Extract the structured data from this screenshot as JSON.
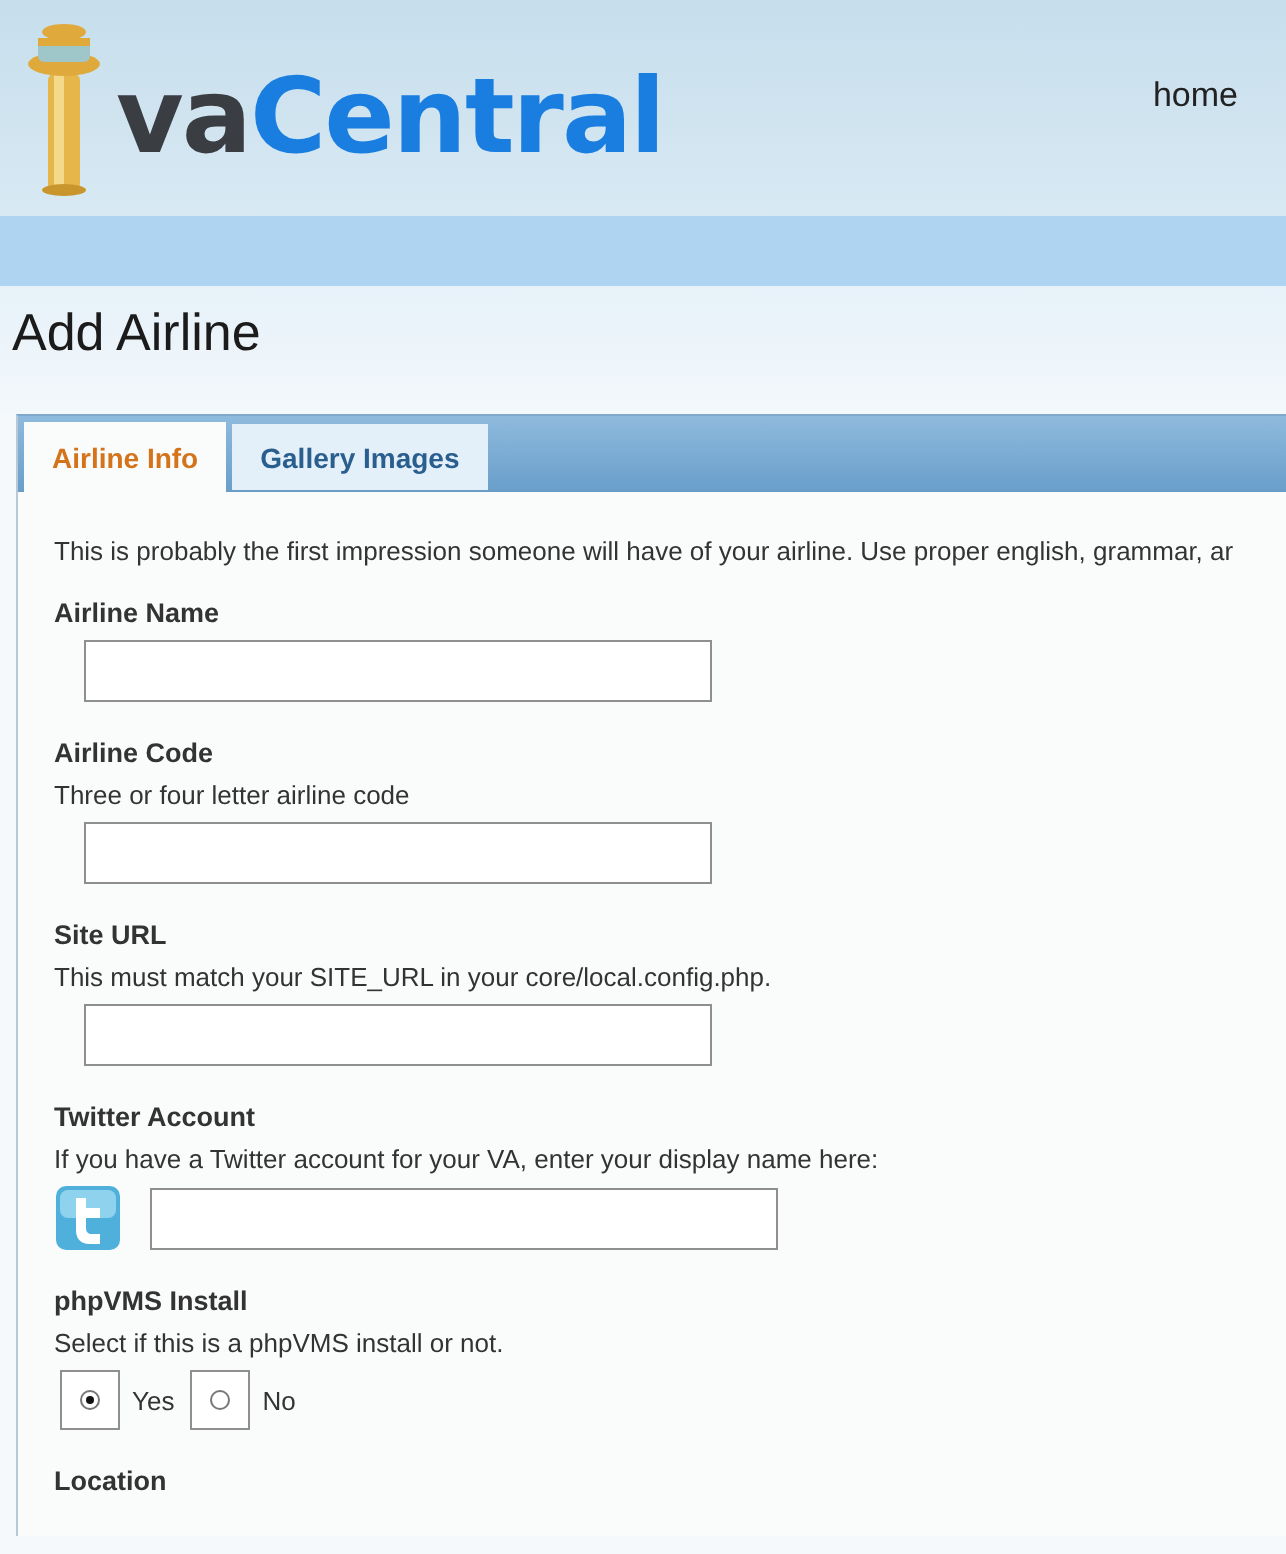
{
  "header": {
    "logo": {
      "prefix": "va",
      "name": "Central"
    },
    "nav": [
      "home"
    ]
  },
  "page_title": "Add Airline",
  "tabs": [
    {
      "label": "Airline Info",
      "selected": true
    },
    {
      "label": "Gallery Images",
      "selected": false
    }
  ],
  "intro": "This is probably the first impression someone will have of your airline. Use proper english, grammar, ar",
  "fields": [
    {
      "kind": "text",
      "label": "Airline Name"
    },
    {
      "kind": "text",
      "label": "Airline Code",
      "hint": "Three or four letter airline code"
    },
    {
      "kind": "text",
      "label": "Site URL",
      "hint": "This must match your SITE_URL in your core/local.config.php."
    },
    {
      "kind": "twitter",
      "label": "Twitter Account",
      "hint": "If you have a Twitter account for your VA, enter your display name here:"
    },
    {
      "kind": "radio",
      "label": "phpVMS Install",
      "hint": "Select if this is a phpVMS install or not.",
      "options": [
        {
          "label": "Yes",
          "selected": true
        },
        {
          "label": "No",
          "selected": false
        }
      ]
    },
    {
      "kind": "heading",
      "label": "Location"
    }
  ]
}
